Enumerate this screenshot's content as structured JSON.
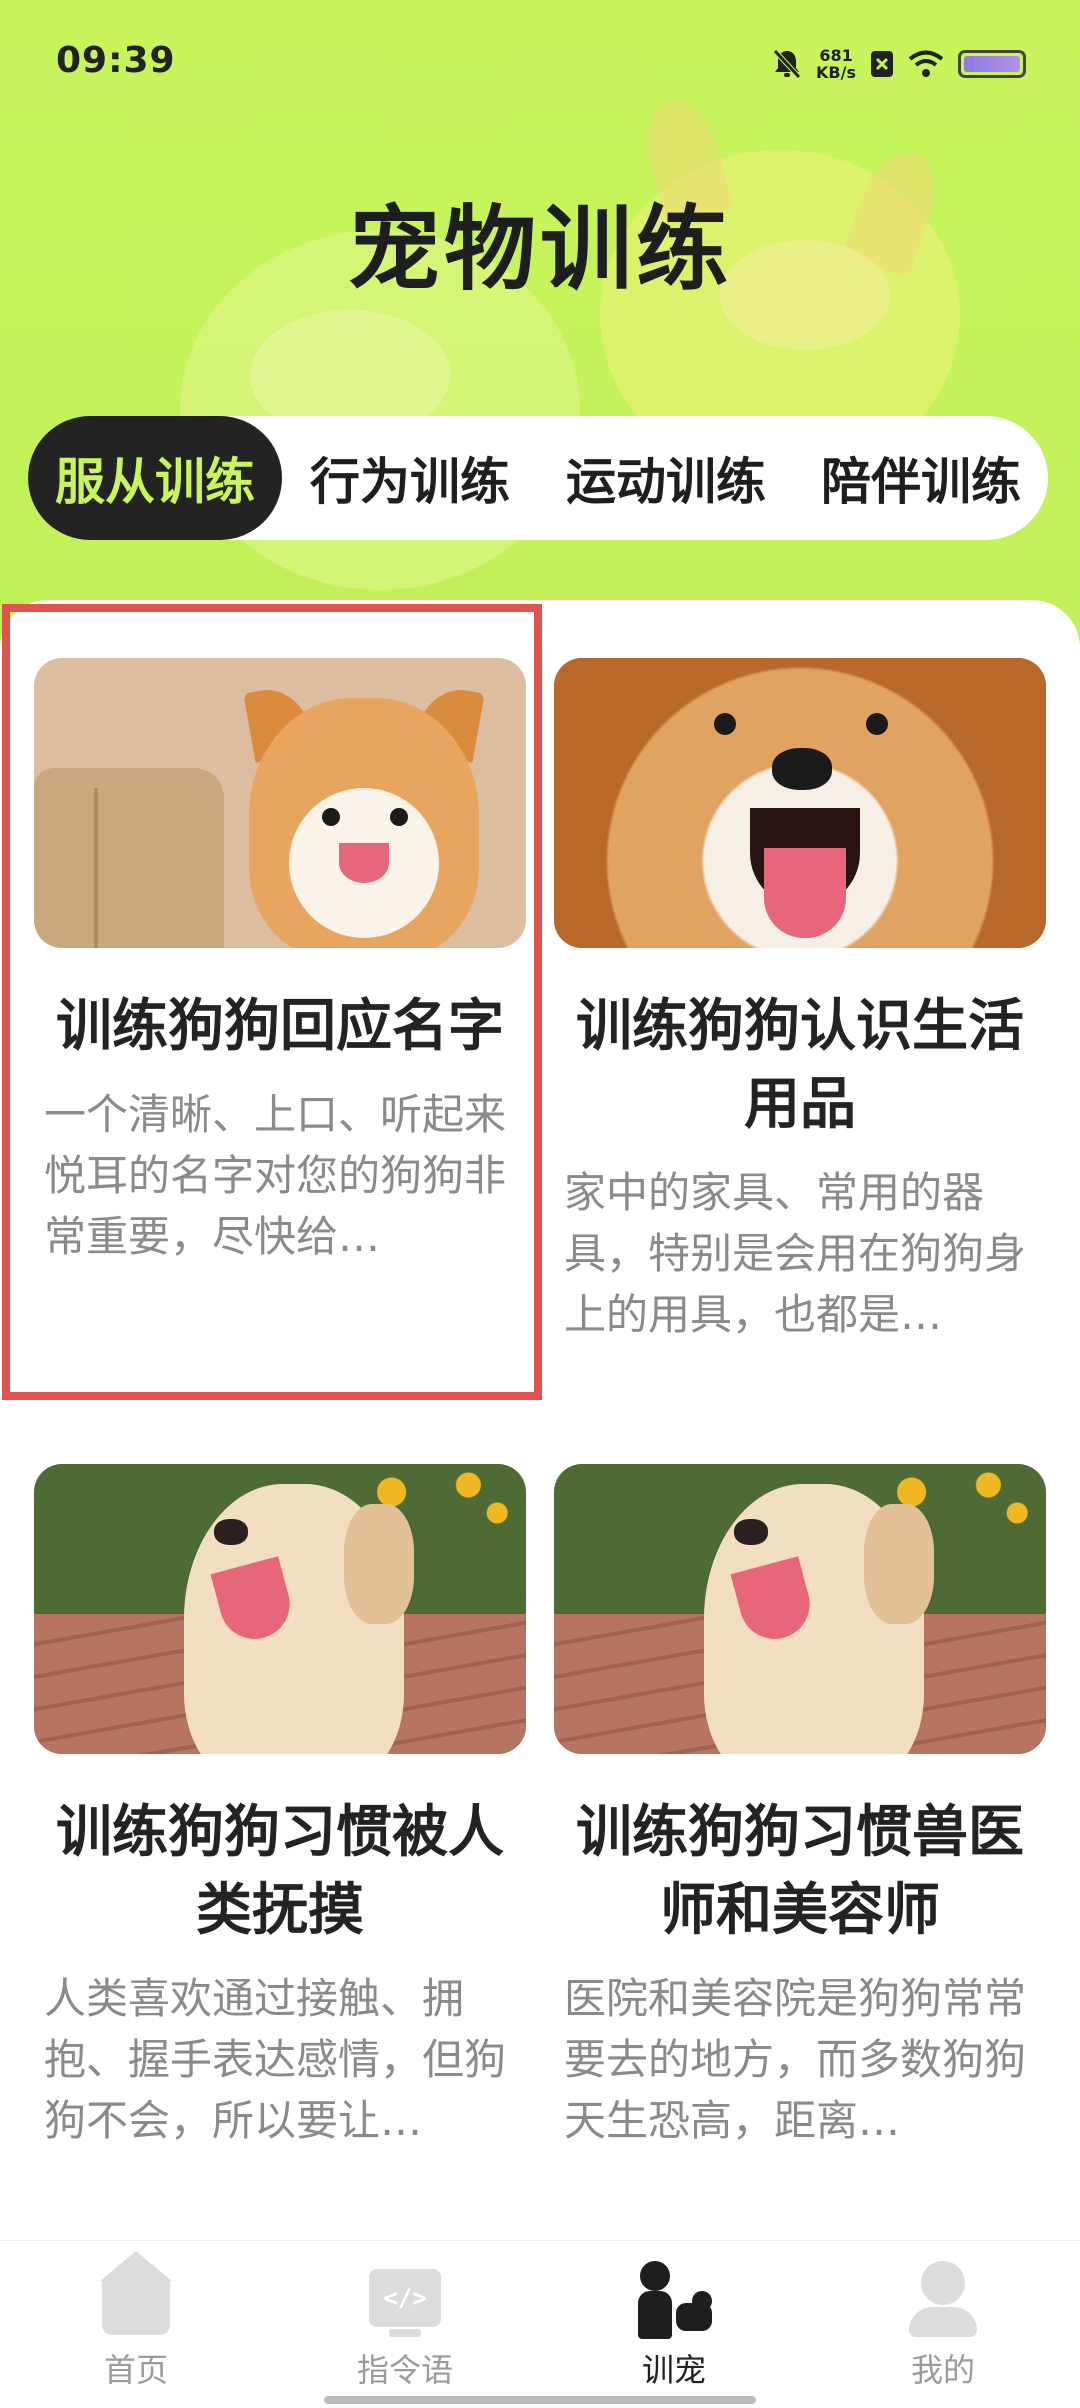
{
  "status_bar": {
    "time": "09:39",
    "net_speed_value": "681",
    "net_speed_unit": "KB/s",
    "icons": [
      "mute-icon",
      "sim-icon",
      "wifi-icon",
      "battery-icon"
    ]
  },
  "header": {
    "title": "宠物训练"
  },
  "tabs": [
    {
      "label": "服从训练",
      "selected": true
    },
    {
      "label": "行为训练",
      "selected": false
    },
    {
      "label": "运动训练",
      "selected": false
    },
    {
      "label": "陪伴训练",
      "selected": false
    }
  ],
  "cards": [
    {
      "title": "训练狗狗回应名字",
      "desc": "一个清晰、上口、听起来悦耳的名字对您的狗狗非常重要，尽快给…",
      "image": "shiba-inu-photo"
    },
    {
      "title": "训练狗狗认识生活用品",
      "desc": "家中的家具、常用的器具，特别是会用在狗狗身上的用具，也都是…",
      "image": "shiba-closeup-photo"
    },
    {
      "title": "训练狗狗习惯被人类抚摸",
      "desc": "人类喜欢通过接触、拥抱、握手表达感情，但狗狗不会，所以要让…",
      "image": "golden-puppy-photo"
    },
    {
      "title": "训练狗狗习惯兽医师和美容师",
      "desc": "医院和美容院是狗狗常常要去的地方，而多数狗狗天生恐高，距离…",
      "image": "golden-puppy-photo"
    }
  ],
  "bottom_nav": [
    {
      "label": "首页",
      "icon": "home-icon",
      "active": false
    },
    {
      "label": "指令语",
      "icon": "code-screen-icon",
      "active": false
    },
    {
      "label": "训宠",
      "icon": "person-walking-dog-icon",
      "active": true
    },
    {
      "label": "我的",
      "icon": "user-icon",
      "active": false
    }
  ],
  "colors": {
    "accent": "#c8f55c",
    "tab_selected_bg": "#232323",
    "highlight_border": "#e3524f"
  }
}
